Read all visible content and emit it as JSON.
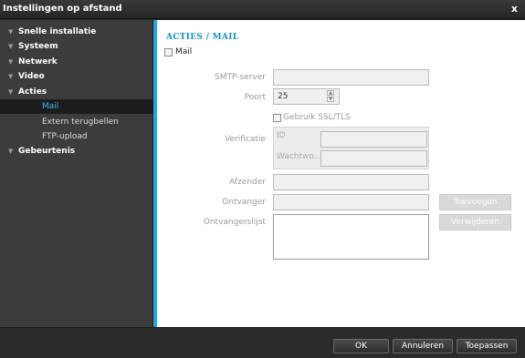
{
  "window": {
    "title": "Instellingen op afstand",
    "close_glyph": "x"
  },
  "sidebar": {
    "items": [
      {
        "label": "Snelle installatie",
        "type": "group"
      },
      {
        "label": "Systeem",
        "type": "group"
      },
      {
        "label": "Netwerk",
        "type": "group"
      },
      {
        "label": "Video",
        "type": "group"
      },
      {
        "label": "Acties",
        "type": "group"
      },
      {
        "label": "Mail",
        "type": "sub",
        "active": true
      },
      {
        "label": "Extern terugbellen",
        "type": "sub"
      },
      {
        "label": "FTP-upload",
        "type": "sub"
      },
      {
        "label": "Gebeurtenis",
        "type": "group"
      }
    ],
    "group_glyph": "▼"
  },
  "main": {
    "section_title": "ACTIES / MAIL",
    "mail_checkbox_label": "Mail",
    "smtp_label": "SMTP-server",
    "smtp_value": "",
    "port_label": "Poort",
    "port_value": "25",
    "spin_up": "▲",
    "spin_down": "▼",
    "ssl_label": "Gebruik SSL/TLS",
    "verification_label": "Verificatie",
    "id_label": "ID",
    "id_value": "",
    "password_label": "Wachtwo...",
    "password_value": "",
    "sender_label": "Afzender",
    "sender_value": "",
    "recipient_label": "Ontvanger",
    "recipient_value": "",
    "recipient_list_label": "Ontvangerslijst",
    "add_button": "Toevoegen",
    "delete_button": "Verwijderen"
  },
  "footer": {
    "ok": "OK",
    "cancel": "Annuleren",
    "apply": "Toepassen"
  },
  "colors": {
    "accent": "#22a6e6",
    "active_text": "#4ab5ee",
    "section_title": "#1590c9"
  }
}
